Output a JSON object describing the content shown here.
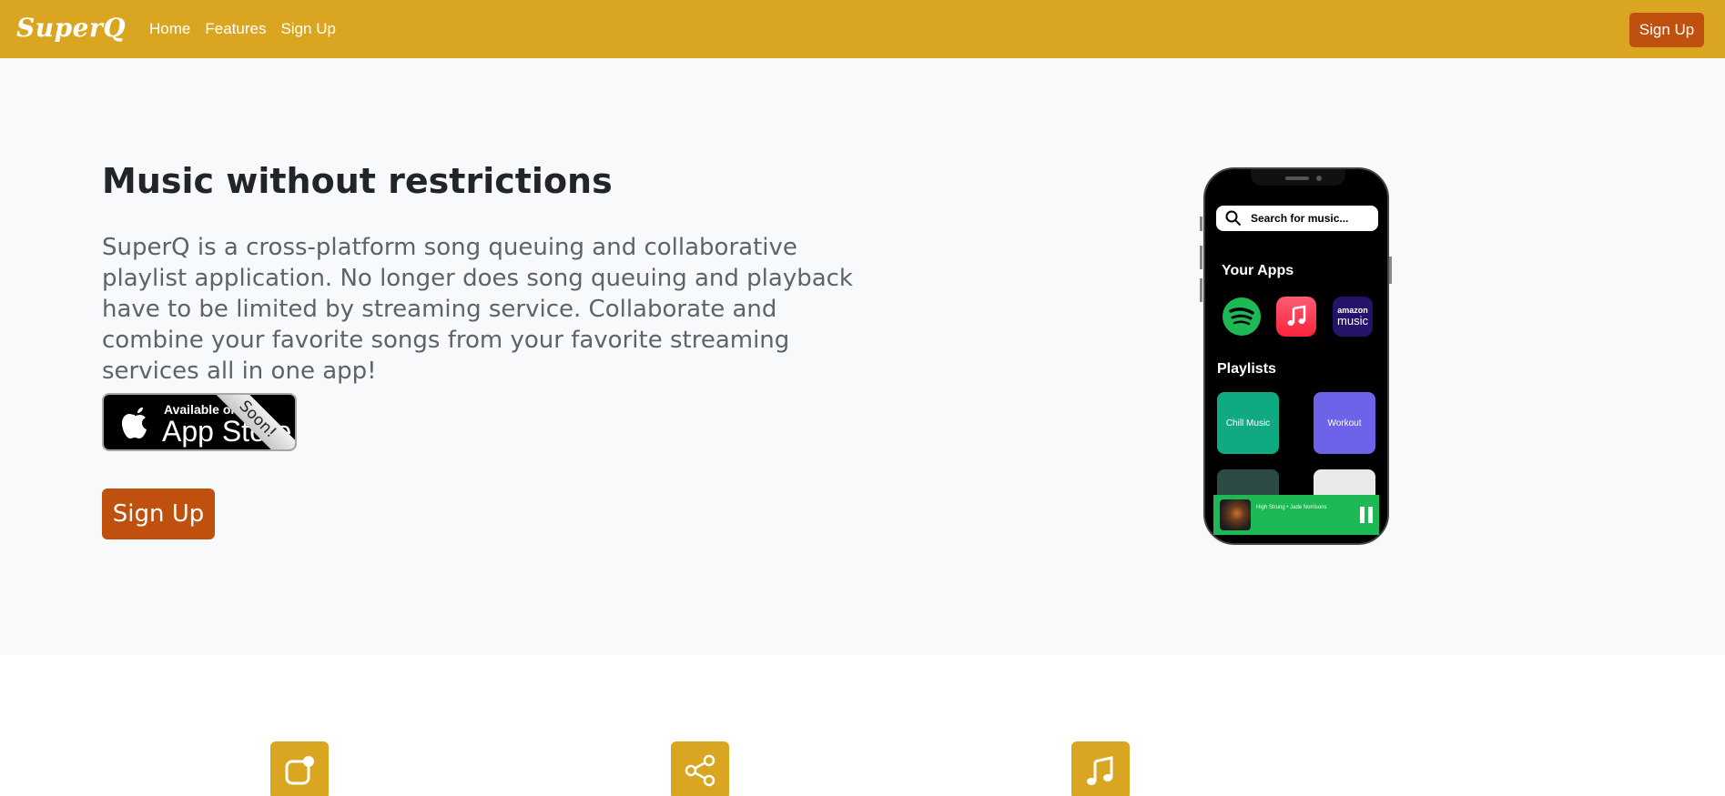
{
  "navbar": {
    "brand": "SuperQ",
    "links": [
      "Home",
      "Features",
      "Sign Up"
    ],
    "signup_label": "Sign Up"
  },
  "hero": {
    "title": "Music without restrictions",
    "description": "SuperQ is a cross-platform song queuing and collaborative playlist application. No longer does song queuing and playback have to be limited by streaming service. Collaborate and combine your favorite songs from your favorite streaming services all in one app!",
    "app_store_badge": {
      "small_text": "Available on",
      "big_text": "App Store",
      "ribbon": "Soon!"
    },
    "signup_label": "Sign Up"
  },
  "phone": {
    "search_placeholder": "Search for music...",
    "your_apps_heading": "Your Apps",
    "apps": [
      "spotify-icon",
      "apple-music-icon",
      "amazon-music-icon"
    ],
    "amazon_label_top": "amazon",
    "amazon_label_bottom": "music",
    "playlists_heading": "Playlists",
    "playlists": [
      {
        "name": "Chill Music",
        "color": "#0fa982"
      },
      {
        "name": "Workout",
        "color": "#6c63e8"
      },
      {
        "name": "",
        "color": "#2e4a45"
      },
      {
        "name": "",
        "color": "#e9e9e9"
      }
    ],
    "now_playing": "High Strung • Jade Norrisons"
  },
  "features": {
    "icons": [
      "app-badge-icon",
      "share-icon",
      "music-note-icon"
    ]
  },
  "colors": {
    "primary": "#daa520",
    "accent": "#c0500e",
    "hero_bg": "#f8f9fa"
  }
}
